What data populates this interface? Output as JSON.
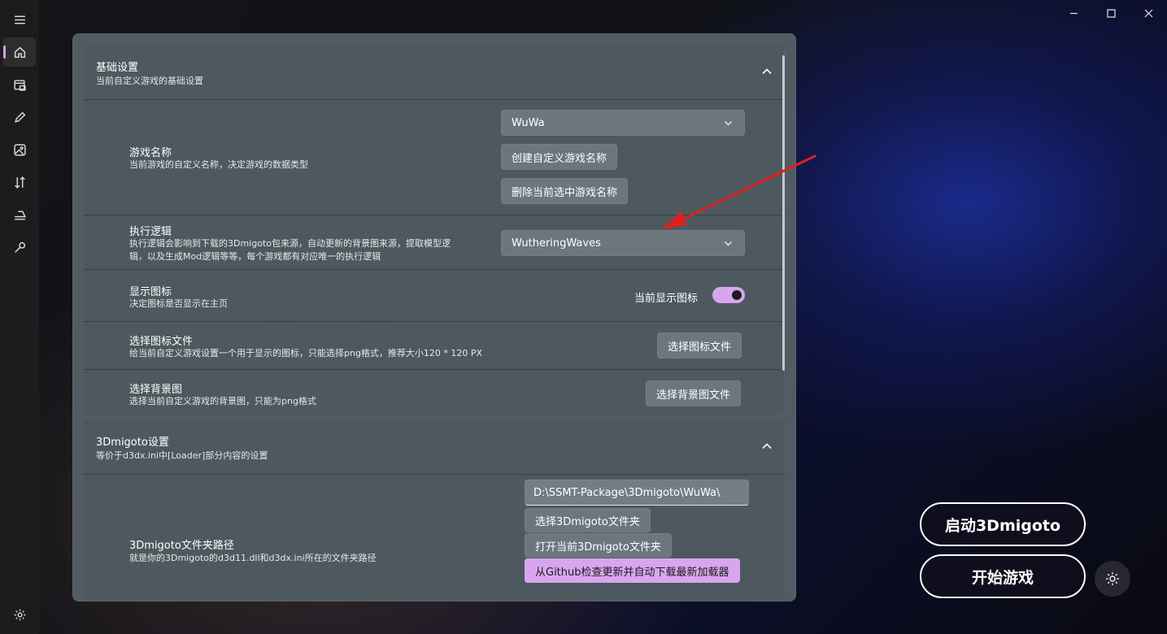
{
  "basic": {
    "title": "基础设置",
    "subtitle": "当前自定义游戏的基础设置",
    "game_name": {
      "title": "游戏名称",
      "desc": "当前游戏的自定义名称，决定游戏的数据类型",
      "selected": "WuWa",
      "create_label": "创建自定义游戏名称",
      "delete_label": "删除当前选中游戏名称"
    },
    "logic": {
      "title": "执行逻辑",
      "desc_line1": "执行逻辑会影响到下载的3Dmigoto包来源，自动更新的背景图来源，提取模型逻",
      "desc_line2": "辑，以及生成Mod逻辑等等，每个游戏都有对应唯一的执行逻辑",
      "selected": "WutheringWaves"
    },
    "show_icon": {
      "title": "显示图标",
      "desc": "决定图标是否显示在主页",
      "toggle_label": "当前显示图标",
      "toggle_on": true
    },
    "icon_file": {
      "title": "选择图标文件",
      "desc": "给当前自定义游戏设置一个用于显示的图标，只能选择png格式，推荐大小120 * 120 PX",
      "button": "选择图标文件"
    },
    "background": {
      "title": "选择背景图",
      "desc": "选择当前自定义游戏的背景图，只能为png格式",
      "button": "选择背景图文件"
    }
  },
  "migoto": {
    "title": "3Dmigoto设置",
    "subtitle": "等价于d3dx.ini中[Loader]部分内容的设置",
    "folder": {
      "title": "3Dmigoto文件夹路径",
      "desc": "就是你的3Dmigoto的d3d11.dll和d3dx.ini所在的文件夹路径",
      "path": "D:\\SSMT-Package\\3Dmigoto\\WuWa\\",
      "select_label": "选择3Dmigoto文件夹",
      "open_label": "打开当前3Dmigoto文件夹",
      "update_label": "从Github检查更新并自动下载最新加载器"
    }
  },
  "actions": {
    "launch_migoto": "启动3Dmigoto",
    "start_game": "开始游戏"
  },
  "colors": {
    "accent": "#d8a6ef",
    "arrow": "#e02020"
  }
}
